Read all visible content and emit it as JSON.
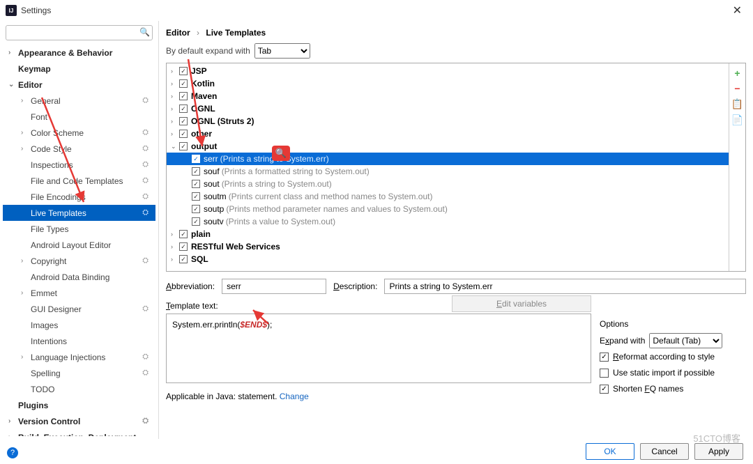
{
  "window": {
    "title": "Settings"
  },
  "search": {
    "placeholder": ""
  },
  "sidebar": {
    "items": [
      {
        "label": "Appearance & Behavior",
        "top": true,
        "expand": true
      },
      {
        "label": "Keymap",
        "top": true
      },
      {
        "label": "Editor",
        "top": true,
        "expand": true,
        "open": true
      },
      {
        "label": "General",
        "sub": true,
        "expand": true,
        "gear": true
      },
      {
        "label": "Font",
        "sub": true
      },
      {
        "label": "Color Scheme",
        "sub": true,
        "expand": true,
        "gear": true
      },
      {
        "label": "Code Style",
        "sub": true,
        "expand": true,
        "gear": true
      },
      {
        "label": "Inspections",
        "sub": true,
        "gear": true
      },
      {
        "label": "File and Code Templates",
        "sub": true,
        "gear": true
      },
      {
        "label": "File Encodings",
        "sub": true,
        "gear": true
      },
      {
        "label": "Live Templates",
        "sub": true,
        "gear": true,
        "selected": true
      },
      {
        "label": "File Types",
        "sub": true
      },
      {
        "label": "Android Layout Editor",
        "sub": true
      },
      {
        "label": "Copyright",
        "sub": true,
        "expand": true,
        "gear": true
      },
      {
        "label": "Android Data Binding",
        "sub": true
      },
      {
        "label": "Emmet",
        "sub": true,
        "expand": true
      },
      {
        "label": "GUI Designer",
        "sub": true,
        "gear": true
      },
      {
        "label": "Images",
        "sub": true
      },
      {
        "label": "Intentions",
        "sub": true
      },
      {
        "label": "Language Injections",
        "sub": true,
        "expand": true,
        "gear": true
      },
      {
        "label": "Spelling",
        "sub": true,
        "gear": true
      },
      {
        "label": "TODO",
        "sub": true
      },
      {
        "label": "Plugins",
        "top": true
      },
      {
        "label": "Version Control",
        "top": true,
        "expand": true,
        "gear": true
      },
      {
        "label": "Build, Execution, Deployment",
        "top": true,
        "expand": true
      }
    ]
  },
  "breadcrumb": {
    "root": "Editor",
    "leaf": "Live Templates"
  },
  "expand": {
    "label": "By default expand with",
    "value": "Tab"
  },
  "templates": {
    "groups": [
      {
        "label": "JSP"
      },
      {
        "label": "Kotlin"
      },
      {
        "label": "Maven"
      },
      {
        "label": "OGNL"
      },
      {
        "label": "OGNL (Struts 2)"
      },
      {
        "label": "other"
      },
      {
        "label": "output",
        "open": true,
        "children": [
          {
            "name": "serr",
            "desc": "(Prints a string to System.err)",
            "selected": true
          },
          {
            "name": "souf",
            "desc": "(Prints a formatted string to System.out)"
          },
          {
            "name": "sout",
            "desc": "(Prints a string to System.out)"
          },
          {
            "name": "soutm",
            "desc": "(Prints current class and method names to System.out)"
          },
          {
            "name": "soutp",
            "desc": "(Prints method parameter names and values to System.out)"
          },
          {
            "name": "soutv",
            "desc": "(Prints a value to System.out)"
          }
        ]
      },
      {
        "label": "plain"
      },
      {
        "label": "RESTful Web Services"
      },
      {
        "label": "SQL"
      }
    ]
  },
  "form": {
    "abbr_label": "Abbreviation:",
    "abbr_value": "serr",
    "desc_label": "Description:",
    "desc_value": "Prints a string to System.err",
    "tmpl_label": "Template text:",
    "edit_vars": "Edit variables",
    "code_pre": "System.err.println(",
    "code_var": "$END$",
    "code_post": ");"
  },
  "options": {
    "title": "Options",
    "expand_label": "Expand with",
    "expand_value": "Default (Tab)",
    "reformat": "Reformat according to style",
    "static_import": "Use static import if possible",
    "shorten": "Shorten FQ names"
  },
  "applicable": {
    "text": "Applicable in Java: statement.",
    "change": "Change"
  },
  "footer": {
    "ok": "OK",
    "cancel": "Cancel",
    "apply": "Apply"
  },
  "watermark": "51CTO博客"
}
